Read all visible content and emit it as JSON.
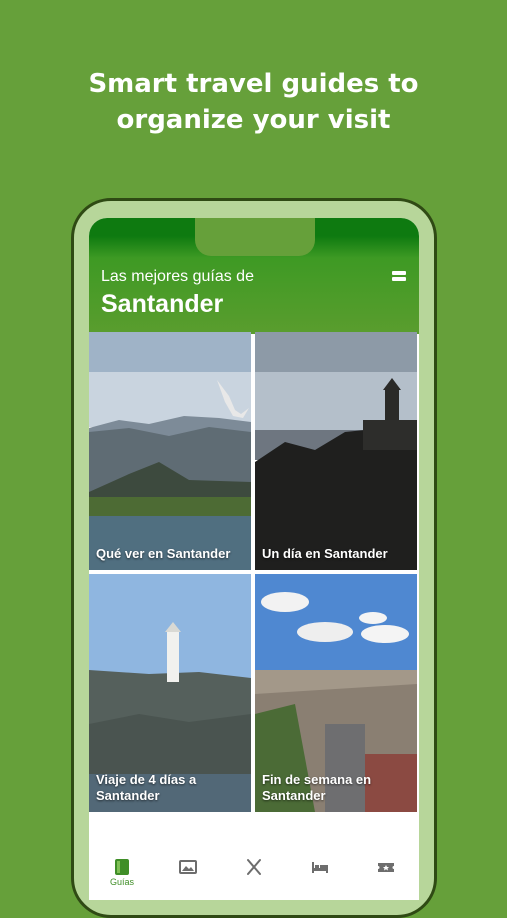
{
  "headline": {
    "line1": "Smart travel guides to",
    "line2": "organize your visit"
  },
  "app": {
    "subtitle": "Las mejores guías de",
    "city": "Santander"
  },
  "guides": [
    {
      "label": "Qué ver en Santander",
      "scene": "mountains-bird"
    },
    {
      "label": "Un día en Santander",
      "scene": "lighthouse-dusk"
    },
    {
      "label": "Viaje de 4 días a Santander",
      "scene": "lighthouse-rocks"
    },
    {
      "label": "Fin de semana en Santander",
      "scene": "city-aerial"
    }
  ],
  "tabs": [
    {
      "label": "Guías",
      "icon": "book-icon",
      "active": true
    },
    {
      "label": "",
      "icon": "image-icon",
      "active": false
    },
    {
      "label": "",
      "icon": "utensils-icon",
      "active": false
    },
    {
      "label": "",
      "icon": "bed-icon",
      "active": false
    },
    {
      "label": "",
      "icon": "ticket-icon",
      "active": false
    }
  ],
  "colors": {
    "background": "#66a03a",
    "header": "#0e7a10",
    "accent": "#3f8e27"
  }
}
